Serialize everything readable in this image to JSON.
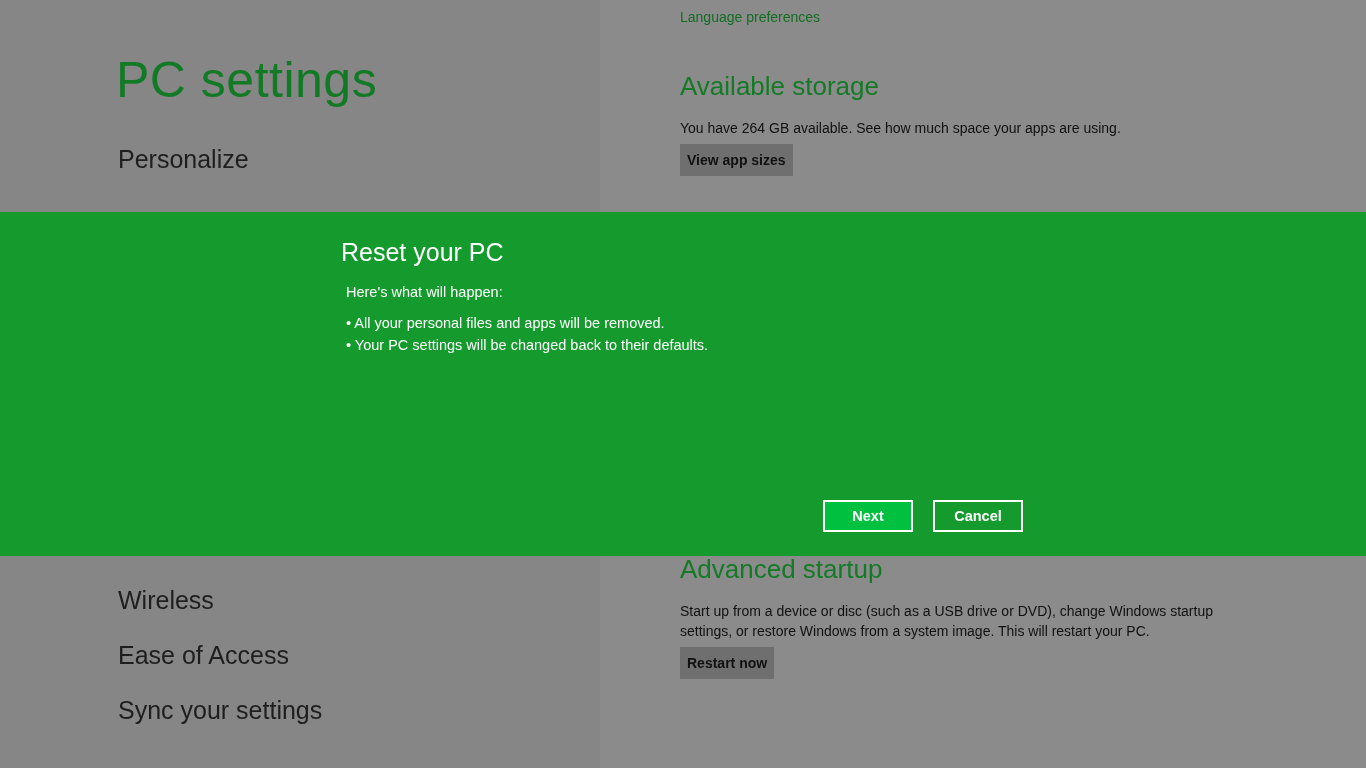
{
  "sidebar": {
    "title": "PC settings",
    "items_top": [
      {
        "label": "Personalize"
      }
    ],
    "items_bottom": [
      {
        "label": "Wireless"
      },
      {
        "label": "Ease of Access"
      },
      {
        "label": "Sync your settings"
      }
    ]
  },
  "content": {
    "link": "Language preferences",
    "sections": [
      {
        "heading": "Available storage",
        "text": "You have 264 GB available. See how much space your apps are using.",
        "button": "View app sizes"
      },
      {
        "heading": "Advanced startup",
        "text": "Start up from a device or disc (such as a USB drive or DVD), change Windows startup settings, or restore Windows from a system image. This will restart your PC.",
        "button": "Restart now"
      }
    ]
  },
  "dialog": {
    "title": "Reset your PC",
    "intro": "Here's what will happen:",
    "bullets": [
      "• All your personal files and apps will be removed.",
      "• Your PC settings will be changed back to their defaults."
    ],
    "buttons": [
      {
        "label": "Next",
        "kind": "primary"
      },
      {
        "label": "Cancel",
        "kind": "secondary"
      }
    ]
  }
}
